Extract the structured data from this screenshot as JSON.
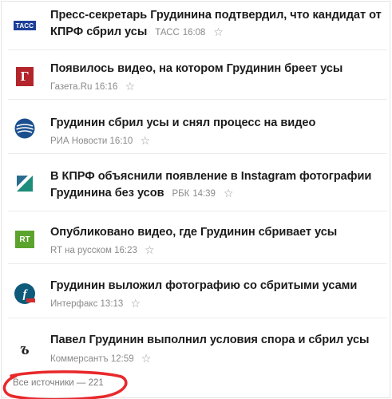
{
  "news": [
    {
      "headline_text": "Пресс-секретарь Грудинина подтвердил, что кандидат от КПРФ сбрил усы",
      "source": "ТАСС",
      "time": "16:08",
      "logo_text": "ТАСС",
      "logo_color": "#1d3f9a",
      "icon": "tass-logo-icon"
    },
    {
      "headline_text": "Появилось видео, на котором Грудинин бреет усы",
      "source": "Газета.Ru",
      "time": "16:16",
      "logo_text": "Г",
      "logo_color": "#b3242b",
      "icon": "gazeta-logo-icon"
    },
    {
      "headline_text": "Грудинин сбрил усы и снял процесс на видео",
      "source": "РИА Новости",
      "time": "16:10",
      "logo_color": "#1a4f8f",
      "icon": "ria-logo-icon"
    },
    {
      "headline_text": "В КПРФ объяснили появление в Instagram фотографии Грудинина без усов",
      "source": "РБК",
      "time": "14:39",
      "logo_color": "#1e8c7a",
      "icon": "rbc-logo-icon"
    },
    {
      "headline_text": "Опубликовано видео, где Грудинин сбривает усы",
      "source": "RT на русском",
      "time": "16:23",
      "logo_text": "RT",
      "logo_color": "#5aa42d",
      "icon": "rt-logo-icon"
    },
    {
      "headline_text": "Грудинин выложил фотографию со сбритыми усами",
      "source": "Интерфакс",
      "time": "13:13",
      "logo_color": "#0d5a7a",
      "icon": "interfax-logo-icon"
    },
    {
      "headline_text": "Павел Грудинин выполнил условия спора и сбрил усы",
      "source": "Коммерсантъ",
      "time": "12:59",
      "logo_color": "#222222",
      "icon": "kommersant-logo-icon"
    }
  ],
  "star_glyph": "☆",
  "footer": {
    "all_sources_text": "Все источники — 221"
  },
  "highlight_color": "#e8282b"
}
